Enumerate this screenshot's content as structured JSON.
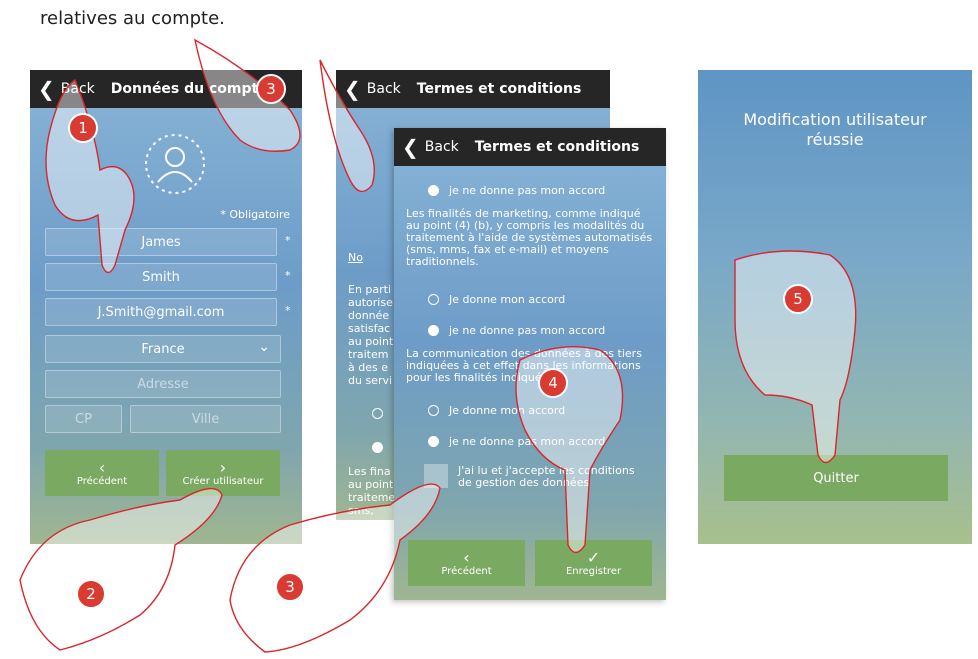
{
  "intro_text": "relatives au compte.",
  "screen1": {
    "back_label": "Back",
    "title": "Données du compte",
    "required_note": "* Obligatoire",
    "first_name": "James",
    "last_name": "Smith",
    "email": "J.Smith@gmail.com",
    "country": "France",
    "address_placeholder": "Adresse",
    "zip_placeholder": "CP",
    "city_placeholder": "Ville",
    "prev_label": "Précédent",
    "create_label": "Créer utilisateur"
  },
  "screen2": {
    "back_label": "Back",
    "title": "Termes et conditions",
    "fragments": [
      "No",
      "En parti",
      "autorise",
      "donnée",
      "satisfac",
      "au point",
      "traitem",
      "à des e",
      "du servi",
      "Les fina",
      "au point",
      "traiteme",
      "sms,"
    ]
  },
  "screen3": {
    "back_label": "Back",
    "title": "Termes et conditions",
    "opt_no_1": "je ne donne pas mon accord",
    "para_marketing": "Les finalités de marketing, comme indiqué au point (4) (b), y compris les modalités du traitement à l'aide de systèmes automatisés (sms, mms, fax et e-mail) et moyens traditionnels.",
    "opt_yes_2": "Je donne mon accord",
    "opt_no_2": "je ne donne pas mon accord",
    "para_third": "La communication des données à des tiers indiquées à cet effet dans les informations pour les finalités indiquées",
    "opt_yes_3": "Je donne mon accord",
    "opt_no_3": "je ne donne pas mon accord",
    "checkbox_label": "J'ai lu et j'accepte les conditions de gestion des données",
    "prev_label": "Précédent",
    "save_label": "Enregistrer"
  },
  "screen4": {
    "message": "Modification utilisateur réussie",
    "quit_label": "Quitter"
  },
  "badges": [
    "1",
    "2",
    "3",
    "3",
    "4",
    "5"
  ],
  "colors": {
    "badge": "#d93a32",
    "button": "#7aaa62",
    "header": "#262626",
    "hand_outline": "#d9262c"
  }
}
